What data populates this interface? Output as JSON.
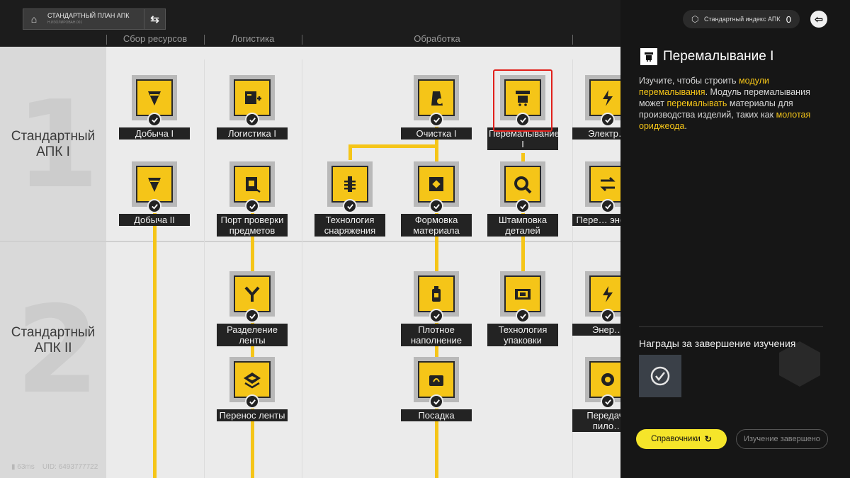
{
  "header": {
    "plan_title": "СТАНДАРТНЫЙ ПЛАН АПК",
    "plan_subtitle": "Н.ИЗОЛИРОВАН.001",
    "columns": [
      "Сбор ресурсов",
      "Логистика",
      "Обработка"
    ]
  },
  "tiers": [
    {
      "label": "Стандартный АПК I",
      "digit": "1"
    },
    {
      "label": "Стандартный АПК II",
      "digit": "2"
    }
  ],
  "nodes": [
    {
      "label": "Добыча I",
      "icon": "drill-icon",
      "completed": true
    },
    {
      "label": "Логистика I",
      "icon": "logistics-icon",
      "completed": true
    },
    {
      "label": "Очистка I",
      "icon": "refining-icon",
      "completed": true
    },
    {
      "label": "Перемалывание I",
      "icon": "grinding-icon",
      "completed": true,
      "selected": true
    },
    {
      "label": "Электр…",
      "icon": "electric-icon",
      "completed": true
    },
    {
      "label": "Добыча II",
      "icon": "drill-icon",
      "completed": true
    },
    {
      "label": "Порт проверки предметов",
      "icon": "item-port-icon",
      "completed": true
    },
    {
      "label": "Технология снаряжения",
      "icon": "equipment-icon",
      "completed": true
    },
    {
      "label": "Формовка материала",
      "icon": "molding-icon",
      "completed": true
    },
    {
      "label": "Штамповка деталей",
      "icon": "stamping-icon",
      "completed": true
    },
    {
      "label": "Пере… энер…",
      "icon": "transfer-icon",
      "completed": true
    },
    {
      "label": "Разделение ленты",
      "icon": "splitter-icon",
      "completed": true
    },
    {
      "label": "Плотное наполнение",
      "icon": "filling-icon",
      "completed": true
    },
    {
      "label": "Технология упаковки",
      "icon": "packaging-icon",
      "completed": true
    },
    {
      "label": "Энер…",
      "icon": "energy-icon",
      "completed": true
    },
    {
      "label": "Перенос ленты",
      "icon": "belt-transfer-icon",
      "completed": true
    },
    {
      "label": "Посадка",
      "icon": "planting-icon",
      "completed": true
    },
    {
      "label": "Передача пило…",
      "icon": "transmission-icon",
      "completed": true
    }
  ],
  "status": {
    "ping": "63ms",
    "uid": "UID: 6493777722"
  },
  "panel": {
    "index_label": "Стандартный индекс АПК",
    "index_value": "0",
    "title": "Перемалывание I",
    "desc": {
      "p1": "Изучите, чтобы строить ",
      "h1": "модули перемалывания",
      "p2": ". Модуль перемалывания может ",
      "h2": "перемалывать",
      "p3": " материалы для производства изделий, таких как ",
      "h3": "молотая ориджеода",
      "p4": "."
    },
    "rewards_title": "Награды за завершение изучения",
    "guides_label": "Справочники",
    "done_label": "Изучение завершено"
  },
  "colors": {
    "accent": "#f5c518",
    "highlight_text": "#f5c518",
    "selection": "#e0201b"
  }
}
